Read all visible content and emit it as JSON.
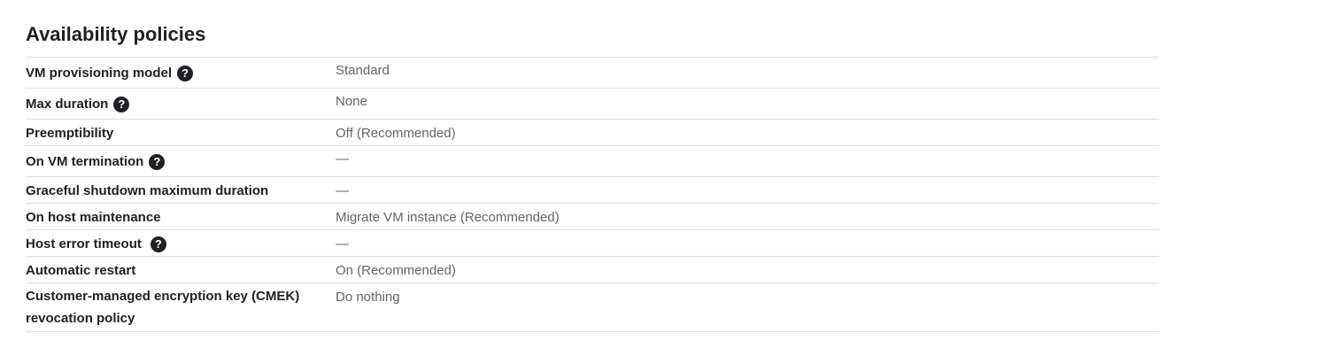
{
  "section": {
    "title": "Availability policies"
  },
  "rows": [
    {
      "label": "VM provisioning model",
      "value": "Standard"
    },
    {
      "label": "Max duration",
      "value": "None"
    },
    {
      "label": "Preemptibility",
      "value": "Off (Recommended)"
    },
    {
      "label": "On VM termination",
      "value": "—"
    },
    {
      "label": "Graceful shutdown maximum duration",
      "value": "—"
    },
    {
      "label": "On host maintenance",
      "value": "Migrate VM instance (Recommended)"
    },
    {
      "label": "Host error timeout",
      "value": "—"
    },
    {
      "label": "Automatic restart",
      "value": "On (Recommended)"
    },
    {
      "label_line1": "Customer-managed encryption key (CMEK)",
      "label_line2": "revocation policy",
      "value": "Do nothing"
    }
  ],
  "icons": {
    "help": "help-circle-icon",
    "help_glyph": "?"
  }
}
